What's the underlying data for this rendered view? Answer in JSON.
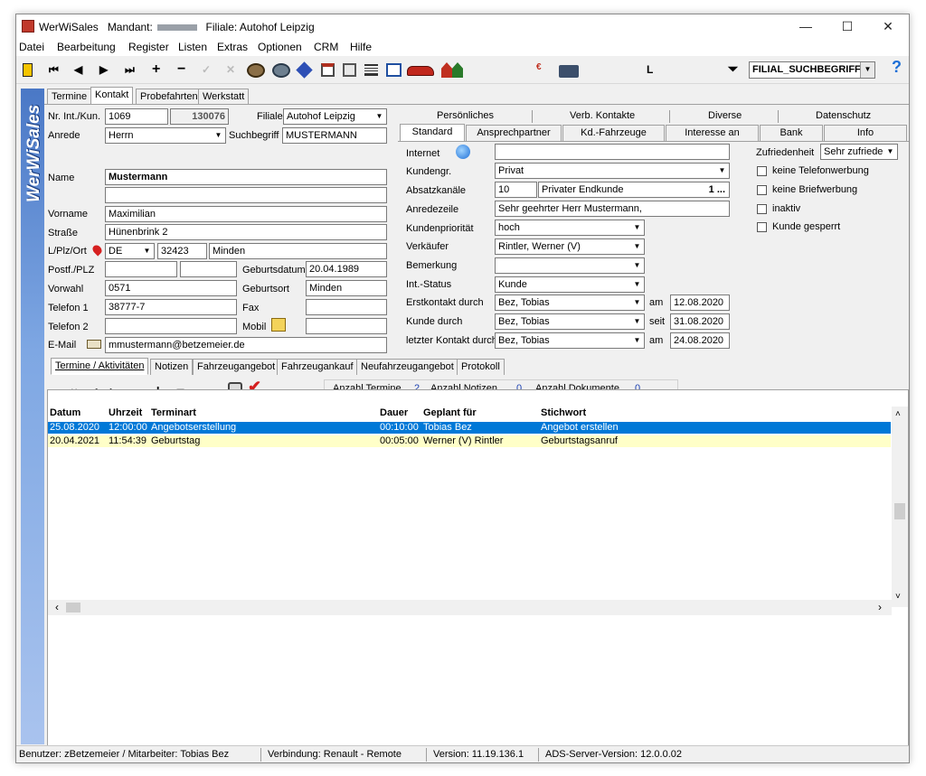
{
  "window": {
    "app_name": "WerWiSales",
    "mandant_label": "Mandant:",
    "filiale_label": "Filiale: Autohof Leipzig",
    "minimize": "—",
    "maximize": "☐",
    "close": "✕"
  },
  "menu": [
    "Datei",
    "Bearbeitung",
    "Register",
    "Listen",
    "Extras",
    "Optionen",
    "CRM",
    "Hilfe"
  ],
  "toolbar": {
    "nav_first": "⏮",
    "nav_prev": "◀",
    "nav_next": "▶",
    "nav_last": "⏭",
    "add": "+",
    "remove": "−",
    "letter_l": "L",
    "filter_select": "FILIAL_SUCHBEGRIFF",
    "help": "?"
  },
  "sidebar": {
    "brand": "WerWiSales"
  },
  "main_tabs": [
    "Termine",
    "Kontakt",
    "Probefahrten",
    "Werkstatt"
  ],
  "form": {
    "nr_label": "Nr. Int./Kun.",
    "nr_int": "1069",
    "nr_kun": "130076",
    "filiale_label": "Filiale",
    "filiale_value": "Autohof Leipzig",
    "anrede_label": "Anrede",
    "anrede_value": "Herrn",
    "suchbegriff_label": "Suchbegriff",
    "suchbegriff_value": "MUSTERMANN",
    "name_label": "Name",
    "name_value": "Mustermann",
    "name2_value": "",
    "vorname_label": "Vorname",
    "vorname_value": "Maximilian",
    "strasse_label": "Straße",
    "strasse_value": "Hünenbrink 2",
    "lplzort_label": "L/Plz/Ort",
    "land_value": "DE",
    "plz_value": "32423",
    "ort_value": "Minden",
    "postf_label": "Postf./PLZ",
    "geburtsdatum_label": "Geburtsdatum",
    "geburtsdatum_value": "20.04.1989",
    "vorwahl_label": "Vorwahl",
    "vorwahl_value": "0571",
    "geburtsort_label": "Geburtsort",
    "geburtsort_value": "Minden",
    "telefon1_label": "Telefon 1",
    "telefon1_value": "38777-7",
    "fax_label": "Fax",
    "telefon2_label": "Telefon 2",
    "mobil_label": "Mobil",
    "email_label": "E-Mail",
    "email_value": "mmustermann@betzemeier.de"
  },
  "right_tabs_top": [
    "Persönliches",
    "Verb. Kontakte",
    "Diverse",
    "Datenschutz"
  ],
  "right_tabs_bottom": [
    "Standard",
    "Ansprechpartner",
    "Kd.-Fahrzeuge",
    "Interesse an",
    "Bank",
    "Info"
  ],
  "standard": {
    "internet_label": "Internet",
    "kundengr_label": "Kundengr.",
    "kundengr_value": "Privat",
    "absatz_label": "Absatzkanäle",
    "absatz_code": "10",
    "absatz_value": "Privater Endkunde",
    "absatz_count": "1 ...",
    "anredezeile_label": "Anredezeile",
    "anredezeile_value": "Sehr geehrter Herr Mustermann,",
    "prio_label": "Kundenpriorität",
    "prio_value": "hoch",
    "verkaeufer_label": "Verkäufer",
    "verkaeufer_value": "Rintler, Werner (V)",
    "bemerkung_label": "Bemerkung",
    "intstatus_label": "Int.-Status",
    "intstatus_value": "Kunde",
    "erstkontakt_label": "Erstkontakt durch",
    "erstkontakt_value": "Bez, Tobias",
    "erstkontakt_am_label": "am",
    "erstkontakt_am_value": "12.08.2020",
    "kundedurch_label": "Kunde durch",
    "kundedurch_value": "Bez, Tobias",
    "seit_label": "seit",
    "seit_value": "31.08.2020",
    "letzter_label": "letzter Kontakt durch",
    "letzter_value": "Bez, Tobias",
    "letzter_am_label": "am",
    "letzter_am_value": "24.08.2020",
    "zufriedenheit_label": "Zufriedenheit",
    "zufriedenheit_value": "Sehr zufrieden",
    "chk_telefon": "keine Telefonwerbung",
    "chk_brief": "keine Briefwerbung",
    "chk_inaktiv": "inaktiv",
    "chk_gesperrt": "Kunde gesperrt"
  },
  "bottom_tabs": [
    "Termine / Aktivitäten",
    "Notizen",
    "Fahrzeugangebot",
    "Fahrzeugankauf",
    "Neufahrzeugangebot",
    "Protokoll"
  ],
  "counts": {
    "termine_label": "Anzahl Termine",
    "termine_value": "2",
    "notizen_label": "Anzahl Notizen",
    "notizen_value": "0",
    "dokumente_label": "Anzahl Dokumente",
    "dokumente_value": "0"
  },
  "grid": {
    "headers": {
      "datum": "Datum",
      "uhrzeit": "Uhrzeit",
      "terminart": "Terminart",
      "dauer": "Dauer",
      "geplant": "Geplant für",
      "stichwort": "Stichwort"
    },
    "rows": [
      {
        "datum": "25.08.2020",
        "uhrzeit": "12:00:00",
        "terminart": "Angebotserstellung",
        "dauer": "00:10:00",
        "geplant": "Tobias Bez",
        "stichwort": "Angebot erstellen"
      },
      {
        "datum": "20.04.2021",
        "uhrzeit": "11:54:39",
        "terminart": "Geburtstag",
        "dauer": "00:05:00",
        "geplant": "Werner (V) Rintler",
        "stichwort": "Geburtstagsanruf"
      }
    ]
  },
  "status": {
    "benutzer": "Benutzer: zBetzemeier / Mitarbeiter: Tobias Bez",
    "verbindung": "Verbindung: Renault - Remote",
    "version": "Version: 11.19.136.1",
    "ads": "ADS-Server-Version: 12.0.0.02"
  },
  "colors": {
    "selected_row": "#0078d7",
    "highlight_row": "#ffffc8",
    "sidebar": "#5b87d4"
  }
}
